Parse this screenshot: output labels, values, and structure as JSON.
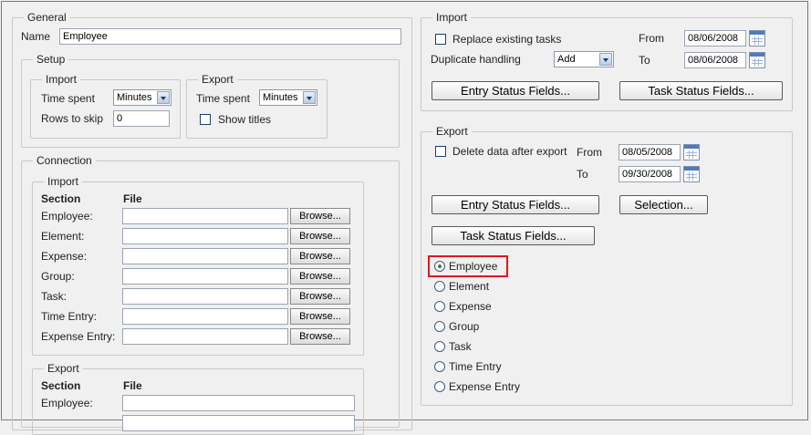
{
  "general": {
    "legend": "General",
    "name_label": "Name",
    "name_value": "Employee",
    "setup": {
      "legend": "Setup",
      "import": {
        "legend": "Import",
        "time_spent_label": "Time spent",
        "time_spent_value": "Minutes",
        "rows_to_skip_label": "Rows to skip",
        "rows_to_skip_value": "0"
      },
      "export": {
        "legend": "Export",
        "time_spent_label": "Time spent",
        "time_spent_value": "Minutes",
        "show_titles_label": "Show titles"
      }
    },
    "connection": {
      "legend": "Connection",
      "import": {
        "legend": "Import",
        "section_header": "Section",
        "file_header": "File",
        "browse_label": "Browse...",
        "rows": [
          {
            "section": "Employee:",
            "file": ""
          },
          {
            "section": "Element:",
            "file": ""
          },
          {
            "section": "Expense:",
            "file": ""
          },
          {
            "section": "Group:",
            "file": ""
          },
          {
            "section": "Task:",
            "file": ""
          },
          {
            "section": "Time Entry:",
            "file": ""
          },
          {
            "section": "Expense Entry:",
            "file": ""
          }
        ]
      },
      "export": {
        "legend": "Export",
        "section_header": "Section",
        "file_header": "File",
        "rows": [
          {
            "section": "Employee:",
            "file": ""
          }
        ]
      }
    }
  },
  "import": {
    "legend": "Import",
    "replace_label": "Replace existing tasks",
    "duplicate_label": "Duplicate handling",
    "duplicate_value": "Add",
    "from_label": "From",
    "from_value": "08/06/2008",
    "to_label": "To",
    "to_value": "08/06/2008",
    "entry_status_button": "Entry Status Fields...",
    "task_status_button": "Task Status Fields..."
  },
  "export": {
    "legend": "Export",
    "delete_label": "Delete data after export",
    "from_label": "From",
    "from_value": "08/05/2008",
    "to_label": "To",
    "to_value": "09/30/2008",
    "entry_status_button": "Entry Status Fields...",
    "selection_button": "Selection...",
    "task_status_button": "Task Status Fields...",
    "selected_option": "Employee",
    "options": [
      "Employee",
      "Element",
      "Expense",
      "Group",
      "Task",
      "Time Entry",
      "Expense Entry"
    ]
  }
}
